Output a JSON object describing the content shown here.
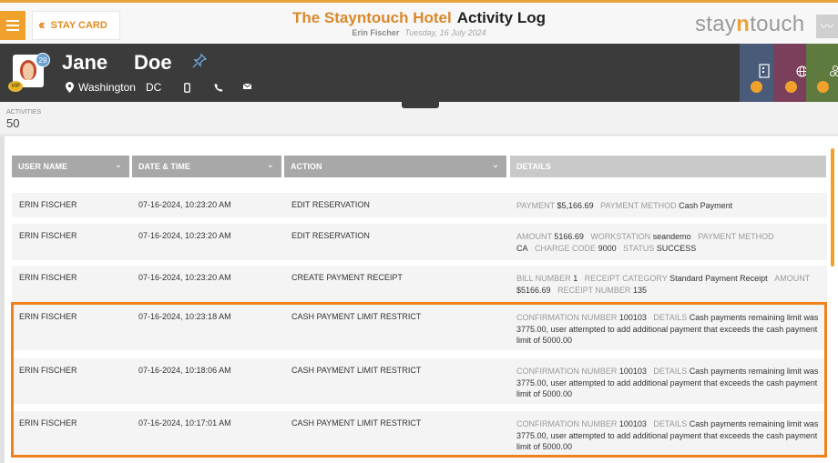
{
  "header": {
    "back_label": "STAY CARD",
    "hotel_name": "The Stayntouch Hotel",
    "page_title": "Activity Log",
    "user_name": "Erin Fischer",
    "date": "Tuesday, 16 July 2024",
    "brand_prefix": "stay",
    "brand_accent": "n",
    "brand_suffix": "touch",
    "accent_color": "#e8a33d"
  },
  "guest": {
    "first_name": "Jane",
    "last_name": "Doe",
    "city": "Washington",
    "state": "DC",
    "badge_count": "29",
    "vip_label": "VIP"
  },
  "activities": {
    "label": "ACTIVITIES",
    "count": "50"
  },
  "table": {
    "columns": [
      "USER NAME",
      "DATE & TIME",
      "ACTION",
      "DETAILS"
    ],
    "rows": [
      {
        "user": "ERIN FISCHER",
        "datetime": "07-16-2024, 10:23:20 AM",
        "action": "EDIT RESERVATION",
        "d": [
          [
            "PAYMENT",
            "$5,166.69"
          ],
          [
            "PAYMENT METHOD",
            "Cash Payment"
          ]
        ]
      },
      {
        "user": "ERIN FISCHER",
        "datetime": "07-16-2024, 10:23:20 AM",
        "action": "EDIT RESERVATION",
        "d": [
          [
            "AMOUNT",
            "5166.69"
          ],
          [
            "WORKSTATION",
            "seandemo"
          ],
          [
            "PAYMENT METHOD",
            "CA"
          ],
          [
            "CHARGE CODE",
            "9000"
          ],
          [
            "STATUS",
            "SUCCESS"
          ]
        ]
      },
      {
        "user": "ERIN FISCHER",
        "datetime": "07-16-2024, 10:23:20 AM",
        "action": "CREATE PAYMENT RECEIPT",
        "d": [
          [
            "BILL NUMBER",
            "1"
          ],
          [
            "RECEIPT CATEGORY",
            "Standard Payment Receipt"
          ],
          [
            "AMOUNT",
            "$5166.69"
          ],
          [
            "RECEIPT NUMBER",
            "135"
          ]
        ]
      },
      {
        "user": "ERIN FISCHER",
        "datetime": "07-16-2024, 10:23:18 AM",
        "action": "CASH PAYMENT LIMIT RESTRICT",
        "d": [
          [
            "CONFIRMATION NUMBER",
            "100103"
          ],
          [
            "DETAILS",
            "Cash payments remaining limit was 3775.00, user attempted to add additional payment that exceeds the cash payment limit of 5000.00"
          ]
        ]
      },
      {
        "user": "ERIN FISCHER",
        "datetime": "07-16-2024, 10:18:06 AM",
        "action": "CASH PAYMENT LIMIT RESTRICT",
        "d": [
          [
            "CONFIRMATION NUMBER",
            "100103"
          ],
          [
            "DETAILS",
            "Cash payments remaining limit was 3775.00, user attempted to add additional payment that exceeds the cash payment limit of 5000.00"
          ]
        ]
      },
      {
        "user": "ERIN FISCHER",
        "datetime": "07-16-2024, 10:17:01 AM",
        "action": "CASH PAYMENT LIMIT RESTRICT",
        "d": [
          [
            "CONFIRMATION NUMBER",
            "100103"
          ],
          [
            "DETAILS",
            "Cash payments remaining limit was 3775.00, user attempted to add additional payment that exceeds the cash payment limit of 5000.00"
          ]
        ]
      }
    ]
  },
  "icons": {
    "menu": "hamburger-menu-icon",
    "back": "double-chevron-left-icon",
    "pin": "pin-icon",
    "location": "location-pin-icon",
    "phone": "mobile-phone-icon",
    "landline": "phone-icon",
    "email": "envelope-icon"
  }
}
